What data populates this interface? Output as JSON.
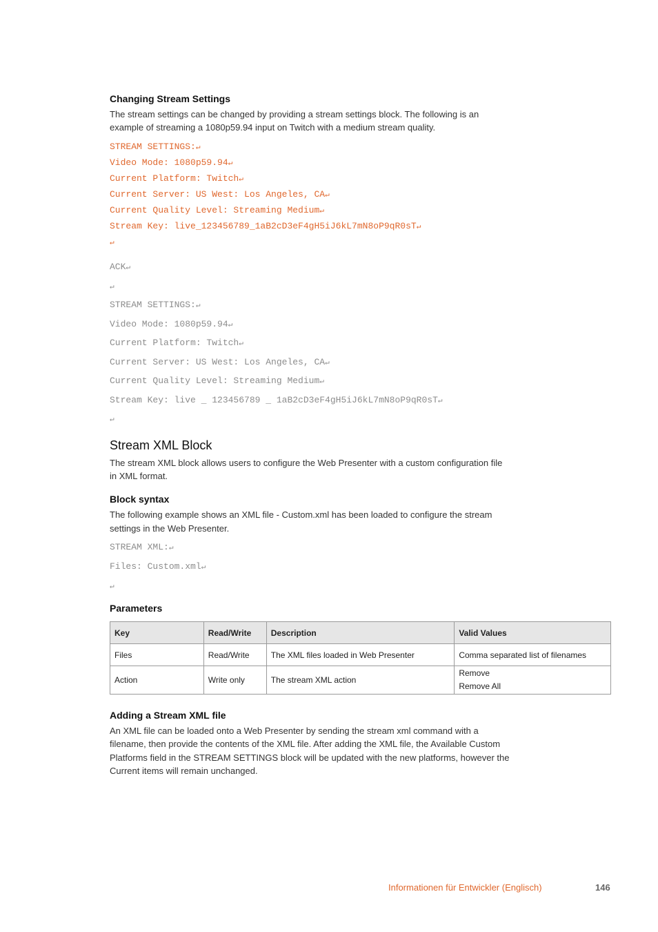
{
  "section1": {
    "heading": "Changing Stream Settings",
    "intro_lines": [
      "The stream settings can be changed by providing a stream settings block. The following is an",
      "example of streaming a 1080p59.94 input on Twitch with a medium stream quality."
    ],
    "command_lines": [
      "STREAM SETTINGS:",
      "Video Mode: 1080p59.94",
      "Current Platform: Twitch",
      "Current Server: US West: Los Angeles, CA",
      "Current Quality Level: Streaming Medium",
      "Stream Key: live_123456789_1aB2cD3eF4gH5iJ6kL7mN8oP9qR0sT",
      ""
    ],
    "response_lines": [
      "ACK",
      "",
      "STREAM SETTINGS:",
      "Video Mode: 1080p59.94",
      "Current Platform: Twitch",
      "Current Server: US West: Los Angeles, CA",
      "Current Quality Level: Streaming Medium",
      "Stream Key: live _ 123456789 _ 1aB2cD3eF4gH5iJ6kL7mN8oP9qR0sT",
      ""
    ],
    "return_symbol": "↵"
  },
  "section2": {
    "heading": "Stream XML Block",
    "intro_lines": [
      "The stream XML block allows users to configure the Web Presenter with a custom configuration file",
      "in XML format."
    ],
    "block_syntax": {
      "heading": "Block syntax",
      "text_lines": [
        "The following example shows an XML file - Custom.xml has been loaded to configure the stream",
        "settings in the Web Presenter."
      ],
      "code_lines": [
        "STREAM XML:",
        "Files: Custom.xml",
        ""
      ]
    },
    "parameters": {
      "heading": "Parameters",
      "columns": [
        "Key",
        "Read/Write",
        "Description",
        "Valid Values"
      ],
      "rows": [
        {
          "key": "Files",
          "rw": "Read/Write",
          "description": "The XML files loaded in Web Presenter",
          "values": [
            "Comma separated list of filenames"
          ]
        },
        {
          "key": "Action",
          "rw": "Write only",
          "description": "The stream XML action",
          "values": [
            "Remove",
            "Remove All"
          ]
        }
      ]
    },
    "adding": {
      "heading": "Adding a Stream XML file",
      "text_lines": [
        "An XML file can be loaded onto a Web Presenter by sending the stream xml command with a",
        "filename, then provide the contents of the XML file. After adding the XML file, the Available Custom",
        "Platforms field in the STREAM SETTINGS block will be updated with the new platforms, however the",
        "Current items will remain unchanged."
      ]
    }
  },
  "footer": {
    "section_label": "Informationen für Entwickler (Englisch)",
    "page_number": "146"
  },
  "colors": {
    "accent_orange": "#e0682e",
    "code_gray": "#8c8c8c",
    "table_header_bg": "#e6e6e6"
  }
}
